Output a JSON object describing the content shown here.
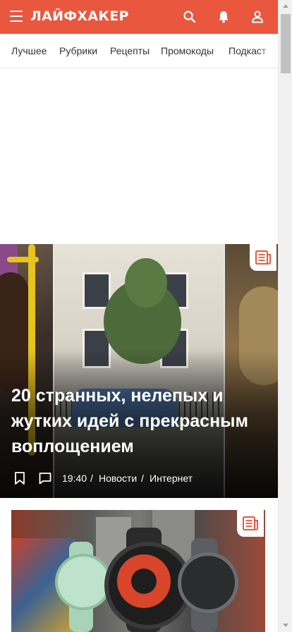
{
  "header": {
    "logo": "ЛАЙФХАКЕР",
    "accent_color": "#e9573f",
    "icons": [
      "menu-icon",
      "search-icon",
      "bell-icon",
      "user-icon"
    ]
  },
  "nav": {
    "items": [
      {
        "label": "Лучшее"
      },
      {
        "label": "Рубрики"
      },
      {
        "label": "Рецепты"
      },
      {
        "label": "Промокоды"
      },
      {
        "label": "Подкаст"
      }
    ]
  },
  "articles": [
    {
      "title": "20 странных, нелепых и жутких идей с прекрасным воплощением",
      "time": "19:40",
      "separator": "/",
      "category": "Новости",
      "tag": "Интернет",
      "badge_icon": "news-icon"
    },
    {
      "title": "",
      "badge_icon": "news-icon"
    }
  ]
}
